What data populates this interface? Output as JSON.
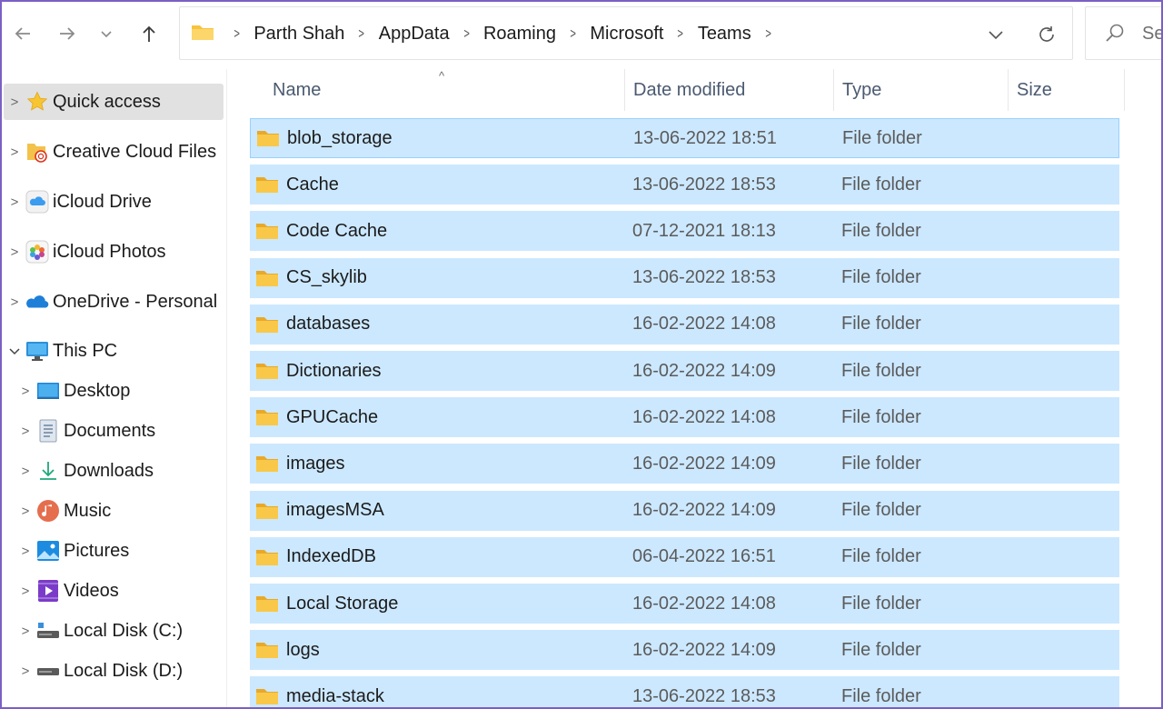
{
  "nav": {
    "back_icon": "arrow-left-icon",
    "forward_icon": "arrow-right-icon",
    "recent_icon": "chevron-down-icon",
    "up_icon": "arrow-up-icon"
  },
  "address_bar": {
    "crumbs": [
      "Parth Shah",
      "AppData",
      "Roaming",
      "Microsoft",
      "Teams"
    ]
  },
  "search": {
    "placeholder": "Se"
  },
  "sidebar": {
    "items": [
      {
        "label": "Quick access",
        "icon": "star-icon",
        "active": true
      },
      {
        "label": "Creative Cloud Files",
        "icon": "creative-cloud-folder-icon"
      },
      {
        "label": "iCloud Drive",
        "icon": "icloud-drive-icon"
      },
      {
        "label": "iCloud Photos",
        "icon": "icloud-photos-icon"
      },
      {
        "label": "OneDrive - Personal",
        "icon": "onedrive-icon"
      },
      {
        "label": "This PC",
        "icon": "monitor-icon",
        "expanded": true
      }
    ],
    "this_pc": [
      {
        "label": "Desktop",
        "icon": "desktop-icon"
      },
      {
        "label": "Documents",
        "icon": "documents-icon"
      },
      {
        "label": "Downloads",
        "icon": "download-icon"
      },
      {
        "label": "Music",
        "icon": "music-icon"
      },
      {
        "label": "Pictures",
        "icon": "pictures-icon"
      },
      {
        "label": "Videos",
        "icon": "videos-icon"
      },
      {
        "label": "Local Disk (C:)",
        "icon": "drive-icon"
      },
      {
        "label": "Local Disk (D:)",
        "icon": "drive-icon"
      }
    ]
  },
  "columns": {
    "name": "Name",
    "date": "Date modified",
    "type": "Type",
    "size": "Size"
  },
  "files": [
    {
      "name": "blob_storage",
      "date": "13-06-2022 18:51",
      "type": "File folder"
    },
    {
      "name": "Cache",
      "date": "13-06-2022 18:53",
      "type": "File folder"
    },
    {
      "name": "Code Cache",
      "date": "07-12-2021 18:13",
      "type": "File folder"
    },
    {
      "name": "CS_skylib",
      "date": "13-06-2022 18:53",
      "type": "File folder"
    },
    {
      "name": "databases",
      "date": "16-02-2022 14:08",
      "type": "File folder"
    },
    {
      "name": "Dictionaries",
      "date": "16-02-2022 14:09",
      "type": "File folder"
    },
    {
      "name": "GPUCache",
      "date": "16-02-2022 14:08",
      "type": "File folder"
    },
    {
      "name": "images",
      "date": "16-02-2022 14:09",
      "type": "File folder"
    },
    {
      "name": "imagesMSA",
      "date": "16-02-2022 14:09",
      "type": "File folder"
    },
    {
      "name": "IndexedDB",
      "date": "06-04-2022 16:51",
      "type": "File folder"
    },
    {
      "name": "Local Storage",
      "date": "16-02-2022 14:08",
      "type": "File folder"
    },
    {
      "name": "logs",
      "date": "16-02-2022 14:09",
      "type": "File folder"
    },
    {
      "name": "media-stack",
      "date": "13-06-2022 18:53",
      "type": "File folder"
    }
  ],
  "colors": {
    "selection": "#cce8ff",
    "selection_border": "#99d1ff",
    "folder": "#f8c33a"
  }
}
